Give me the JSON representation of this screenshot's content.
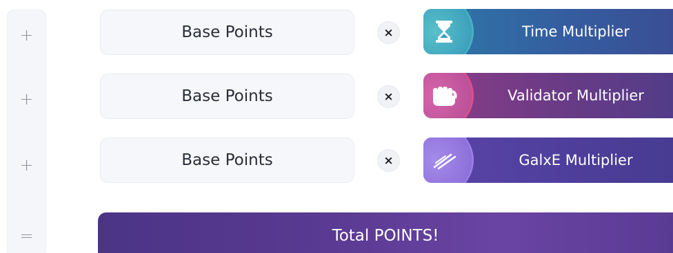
{
  "operators": {
    "row1": "+",
    "row2": "+",
    "row3": "+",
    "total": "="
  },
  "rows": [
    {
      "base_label": "Base Points",
      "times_symbol": "×",
      "multiplier_label": "Time Multiplier",
      "icon": "hourglass-icon",
      "accent": "#46b3c4"
    },
    {
      "base_label": "Base Points",
      "times_symbol": "×",
      "multiplier_label": "Validator Multiplier",
      "icon": "fist-icon",
      "accent": "#e0508b"
    },
    {
      "base_label": "Base Points",
      "times_symbol": "×",
      "multiplier_label": "GalxE Multiplier",
      "icon": "speed-lines-icon",
      "accent": "#9c7fe6"
    }
  ],
  "total": {
    "label": "Total POINTS!"
  }
}
